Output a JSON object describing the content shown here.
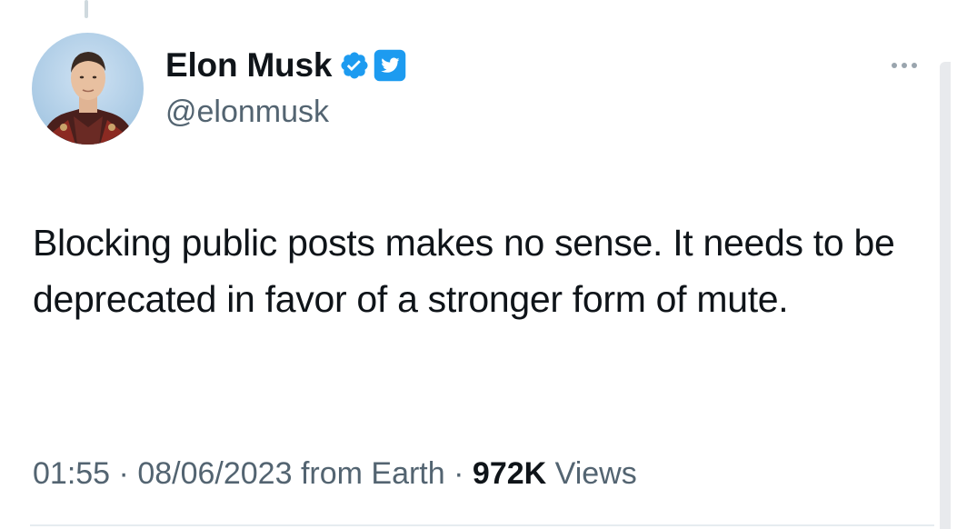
{
  "tweet": {
    "author": {
      "display_name": "Elon Musk",
      "handle": "@elonmusk",
      "verified": true
    },
    "text": "Blocking public posts makes no sense. It needs to be deprecated in favor of a stronger form of mute.",
    "time": "01:55",
    "separator": "·",
    "date": "08/06/2023",
    "source": "from Earth",
    "views_count": "972K",
    "views_label": "Views"
  },
  "colors": {
    "text": "#0f1419",
    "secondary": "#536471",
    "verified_blue": "#1d9bf0",
    "divider": "#e6ecf0"
  },
  "icons": {
    "verified": "verified-checkmark-icon",
    "twitter": "twitter-bird-icon",
    "more": "more-options-icon"
  }
}
